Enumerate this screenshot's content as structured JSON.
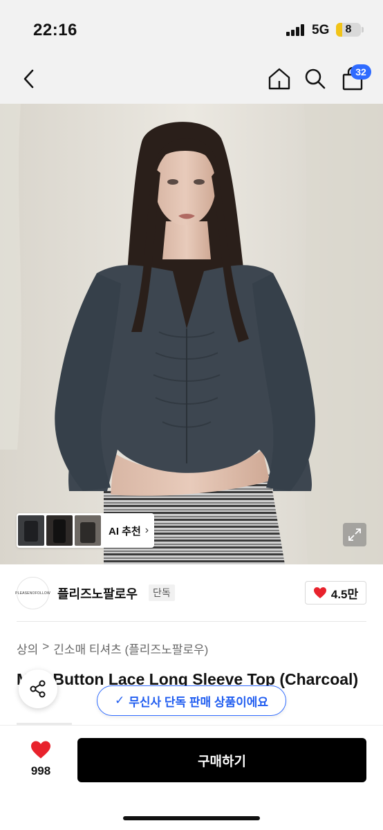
{
  "status_bar": {
    "time": "22:16",
    "network": "5G",
    "battery": "8",
    "battery_level": 0.26
  },
  "nav": {
    "back_icon": "chevron-left-icon",
    "home_icon": "home-icon",
    "search_icon": "search-icon",
    "cart_icon": "shopping-bag-icon",
    "cart_count": "32"
  },
  "hero": {
    "ai_recommend_label": "AI 추천",
    "ai_recommend_chevron": "›",
    "expand_icon": "expand-icon"
  },
  "brand": {
    "logo_text": "PLEASENOFOLLOW",
    "name": "플리즈노팔로우",
    "tag": "단독",
    "like_count": "4.5만"
  },
  "breadcrumb": [
    "상의",
    ">",
    "긴소매 티셔츠 (플리즈노팔로우)"
  ],
  "product": {
    "title": "Mini Button Lace Long Sleeve Top (Charcoal)"
  },
  "floating": {
    "exclusive_label": "무신사 단독 판매 상품이에요",
    "exclusive_check": "✓"
  },
  "bottom": {
    "wish_count": "998",
    "buy_label": "구매하기"
  },
  "colors": {
    "accent_blue": "#2f6bff",
    "heart_red": "#e8222c",
    "buy_black": "#000000",
    "badge_yellow": "#f2c418"
  }
}
